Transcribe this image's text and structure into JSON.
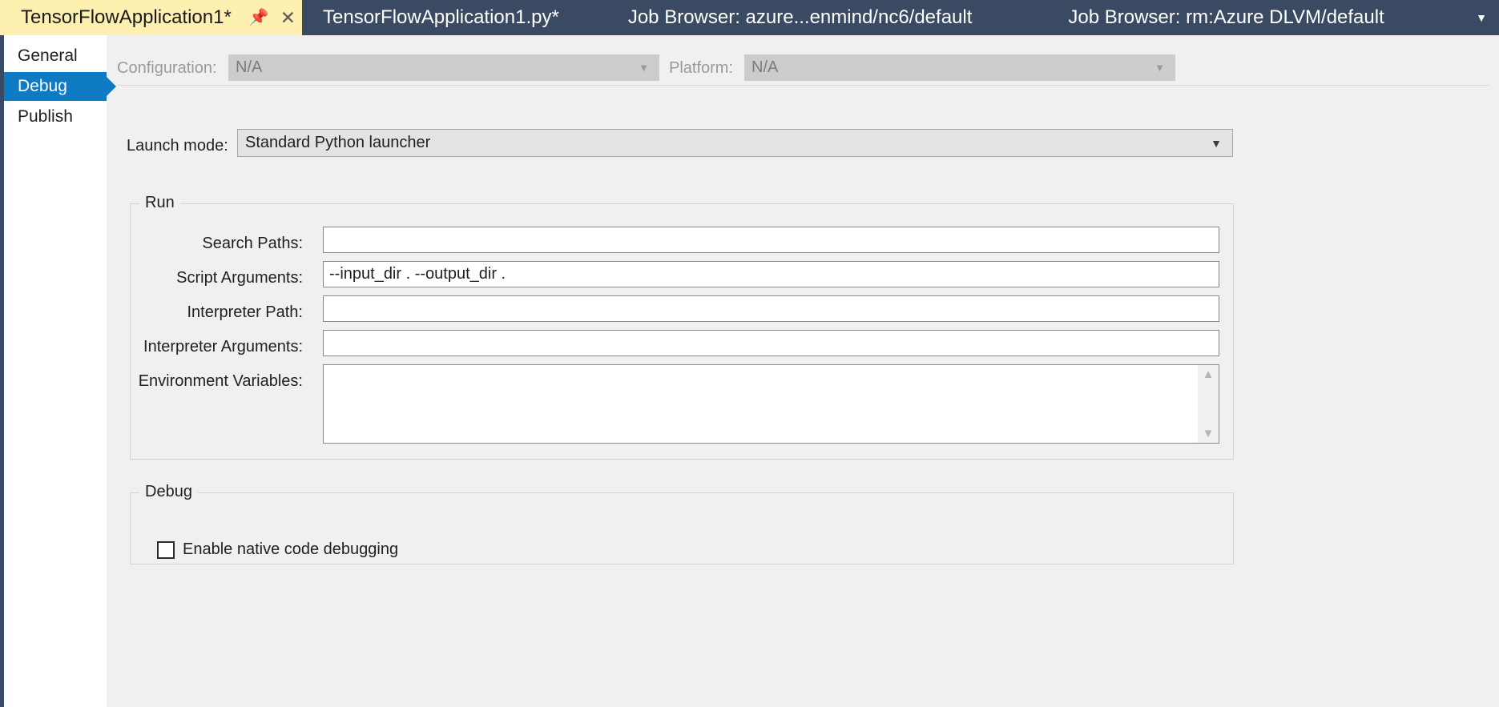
{
  "tabs": [
    {
      "label": "TensorFlowApplication1*",
      "active": true,
      "pin_icon": "pin-icon",
      "close_icon": "close-icon"
    },
    {
      "label": "TensorFlowApplication1.py*",
      "active": false
    },
    {
      "label": "Job Browser: azure...enmind/nc6/default",
      "active": false
    },
    {
      "label": "Job Browser: rm:Azure DLVM/default",
      "active": false
    }
  ],
  "tabstrip": {
    "overflow_icon": "chevron-down-icon",
    "background_color": "#3b4a63",
    "active_tab_color": "#fdf0b0"
  },
  "sidebar": {
    "items": [
      {
        "label": "General",
        "selected": false
      },
      {
        "label": "Debug",
        "selected": true
      },
      {
        "label": "Publish",
        "selected": false
      }
    ],
    "selected_color": "#0e7ac4"
  },
  "toolbar": {
    "configuration_label": "Configuration:",
    "configuration_value": "N/A",
    "platform_label": "Platform:",
    "platform_value": "N/A",
    "chevron_icon": "chevron-down-icon"
  },
  "launch": {
    "label": "Launch mode:",
    "value": "Standard Python launcher",
    "chevron_icon": "chevron-down-icon"
  },
  "run_group": {
    "title": "Run",
    "fields": [
      {
        "label": "Search Paths:",
        "value": ""
      },
      {
        "label": "Script Arguments:",
        "value": "--input_dir . --output_dir ."
      },
      {
        "label": "Interpreter Path:",
        "value": ""
      },
      {
        "label": "Interpreter Arguments:",
        "value": ""
      },
      {
        "label": "Environment Variables:",
        "value": ""
      }
    ],
    "scroll_up_icon": "chevron-up-icon",
    "scroll_down_icon": "chevron-down-icon"
  },
  "debug_group": {
    "title": "Debug",
    "checkbox_label": "Enable native code debugging",
    "checkbox_checked": false
  }
}
